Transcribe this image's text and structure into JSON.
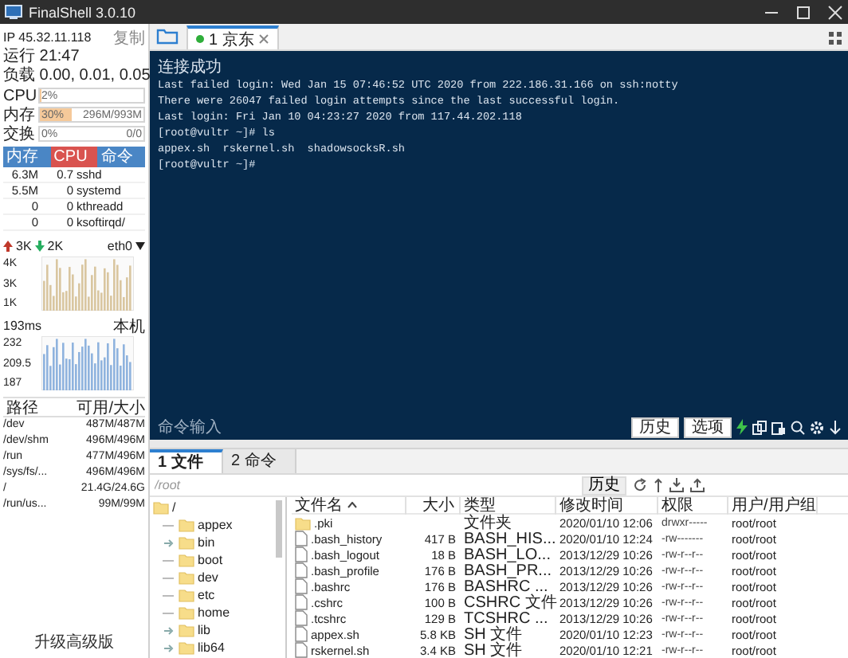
{
  "window": {
    "title": "FinalShell 3.0.10"
  },
  "sidebar": {
    "ip": "IP 45.32.11.118",
    "copy_button": "复制",
    "uptime": "运行 21:47",
    "load": "负载 0.00, 0.01, 0.05",
    "meters": [
      {
        "label": "CPU",
        "level": 0.02,
        "reading": "2%"
      },
      {
        "label": "内存",
        "level": 0.3,
        "reading": "30%",
        "detail": "296M/993M"
      },
      {
        "label": "交换",
        "level": 0,
        "reading": "0%",
        "detail": "0/0"
      }
    ],
    "process_table": {
      "columns": [
        {
          "label": "内存",
          "selected": false
        },
        {
          "label": "CPU",
          "selected": true
        },
        {
          "label": "命令",
          "selected": false
        }
      ],
      "rows": [
        [
          "6.3M",
          "0.7",
          "sshd"
        ],
        [
          "5.5M",
          "0",
          "systemd"
        ],
        [
          "0",
          "0",
          "kthreadd"
        ],
        [
          "0",
          "0",
          "ksoftirqd/"
        ]
      ]
    },
    "network": {
      "upload": "3K",
      "download": "2K",
      "interface": "eth0",
      "axis_labels": [
        "4K",
        "3K",
        "1K"
      ]
    },
    "ping": {
      "latency": "193ms",
      "target": "本机",
      "axis_labels": [
        "232",
        "209.5",
        "187"
      ]
    },
    "disk_table": {
      "columns": [
        "路径",
        "可用/大小"
      ],
      "rows": [
        [
          "/dev",
          "487M/487M"
        ],
        [
          "/dev/shm",
          "496M/496M"
        ],
        [
          "/run",
          "477M/496M"
        ],
        [
          "/sys/fs/...",
          "496M/496M"
        ],
        [
          "/",
          "21.4G/24.6G"
        ],
        [
          "/run/us...",
          "99M/99M"
        ]
      ]
    },
    "upgrade_link": "升级高级版"
  },
  "session_tabs": [
    {
      "label": "1 京东",
      "selected": true,
      "connected": true
    }
  ],
  "terminal": {
    "lines": [
      {
        "kind": "banner",
        "text": "连接成功"
      },
      {
        "kind": "output",
        "text": "Last failed login: Wed Jan 15 07:46:52 UTC 2020 from 222.186.31.166 on ssh:notty"
      },
      {
        "kind": "output",
        "text": "There were 26047 failed login attempts since the last successful login."
      },
      {
        "kind": "output",
        "text": "Last login: Fri Jan 10 04:23:27 2020 from 117.44.202.118"
      },
      {
        "kind": "output",
        "text": "[root@vultr ~]# ls"
      },
      {
        "kind": "output",
        "text": "appex.sh  rskernel.sh  shadowsocksR.sh"
      },
      {
        "kind": "output",
        "text": "[root@vultr ~]#"
      }
    ],
    "command_input": {
      "placeholder": "命令输入"
    },
    "buttons": [
      "历史",
      "选项"
    ]
  },
  "bottom_tabs": [
    {
      "label": "1 文件",
      "selected": true
    },
    {
      "label": "2 命令",
      "selected": false
    }
  ],
  "file_browser": {
    "path": {
      "placeholder": "/root"
    },
    "history_button": "历史",
    "tree": {
      "name": "/",
      "children": [
        {
          "name": "appex",
          "expandable": false
        },
        {
          "name": "bin",
          "expandable": true
        },
        {
          "name": "boot",
          "expandable": false
        },
        {
          "name": "dev",
          "expandable": false
        },
        {
          "name": "etc",
          "expandable": false
        },
        {
          "name": "home",
          "expandable": false
        },
        {
          "name": "lib",
          "expandable": true
        },
        {
          "name": "lib64",
          "expandable": true
        }
      ]
    },
    "columns": [
      {
        "label": "文件名",
        "sorted": true
      },
      {
        "label": "大小",
        "sorted": false
      },
      {
        "label": "类型",
        "sorted": false
      },
      {
        "label": "修改时间",
        "sorted": false
      },
      {
        "label": "权限",
        "sorted": false
      },
      {
        "label": "用户/用户组",
        "sorted": false
      }
    ],
    "rows": [
      {
        "kind": "folder",
        "name": ".pki",
        "type": "文件夹",
        "modified": "2020/01/10 12:06",
        "permissions": "drwxr-----",
        "owner": "root/root"
      },
      {
        "kind": "file",
        "name": ".bash_history",
        "size": "417 B",
        "type": "BASH_HIS...",
        "modified": "2020/01/10 12:24",
        "permissions": "-rw-------",
        "owner": "root/root"
      },
      {
        "kind": "file",
        "name": ".bash_logout",
        "size": "18 B",
        "type": "BASH_LO...",
        "modified": "2013/12/29 10:26",
        "permissions": "-rw-r--r--",
        "owner": "root/root"
      },
      {
        "kind": "file",
        "name": ".bash_profile",
        "size": "176 B",
        "type": "BASH_PR...",
        "modified": "2013/12/29 10:26",
        "permissions": "-rw-r--r--",
        "owner": "root/root"
      },
      {
        "kind": "file",
        "name": ".bashrc",
        "size": "176 B",
        "type": "BASHRC ...",
        "modified": "2013/12/29 10:26",
        "permissions": "-rw-r--r--",
        "owner": "root/root"
      },
      {
        "kind": "file",
        "name": ".cshrc",
        "size": "100 B",
        "type": "CSHRC 文件",
        "modified": "2013/12/29 10:26",
        "permissions": "-rw-r--r--",
        "owner": "root/root"
      },
      {
        "kind": "file",
        "name": ".tcshrc",
        "size": "129 B",
        "type": "TCSHRC ...",
        "modified": "2013/12/29 10:26",
        "permissions": "-rw-r--r--",
        "owner": "root/root"
      },
      {
        "kind": "file",
        "name": "appex.sh",
        "size": "5.8 KB",
        "type": "SH 文件",
        "modified": "2020/01/10 12:23",
        "permissions": "-rw-r--r--",
        "owner": "root/root"
      },
      {
        "kind": "file",
        "name": "rskernel.sh",
        "size": "3.4 KB",
        "type": "SH 文件",
        "modified": "2020/01/10 12:21",
        "permissions": "-rw-r--r--",
        "owner": "root/root"
      }
    ]
  }
}
